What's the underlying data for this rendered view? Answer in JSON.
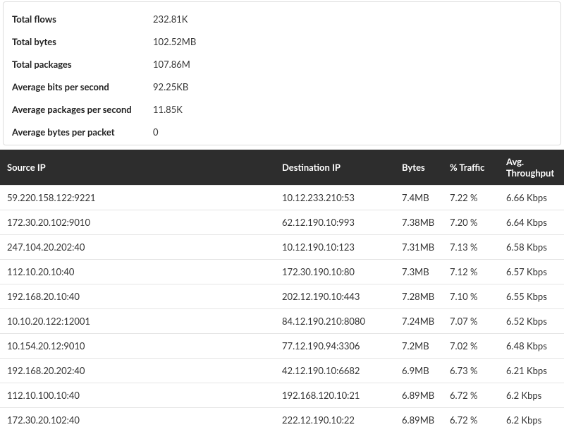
{
  "summary": {
    "rows": [
      {
        "label": "Total flows",
        "value": "232.81K"
      },
      {
        "label": "Total bytes",
        "value": "102.52MB"
      },
      {
        "label": "Total packages",
        "value": "107.86M"
      },
      {
        "label": "Average bits per second",
        "value": "92.25KB"
      },
      {
        "label": "Average packages per second",
        "value": "11.85K"
      },
      {
        "label": "Average bytes per packet",
        "value": "0"
      }
    ]
  },
  "table": {
    "headers": {
      "source": "Source IP",
      "dest": "Destination IP",
      "bytes": "Bytes",
      "pct": "% Traffic",
      "thr": "Avg. Throughput"
    },
    "rows": [
      {
        "source": "59.220.158.122:9221",
        "dest": "10.12.233.210:53",
        "bytes": "7.4MB",
        "pct": "7.22 %",
        "thr": "6.66 Kbps"
      },
      {
        "source": "172.30.20.102:9010",
        "dest": "62.12.190.10:993",
        "bytes": "7.38MB",
        "pct": "7.20 %",
        "thr": "6.64 Kbps"
      },
      {
        "source": "247.104.20.202:40",
        "dest": "10.12.190.10:123",
        "bytes": "7.31MB",
        "pct": "7.13 %",
        "thr": "6.58 Kbps"
      },
      {
        "source": "112.10.20.10:40",
        "dest": "172.30.190.10:80",
        "bytes": "7.3MB",
        "pct": "7.12 %",
        "thr": "6.57 Kbps"
      },
      {
        "source": "192.168.20.10:40",
        "dest": "202.12.190.10:443",
        "bytes": "7.28MB",
        "pct": "7.10 %",
        "thr": "6.55 Kbps"
      },
      {
        "source": "10.10.20.122:12001",
        "dest": "84.12.190.210:8080",
        "bytes": "7.24MB",
        "pct": "7.07 %",
        "thr": "6.52 Kbps"
      },
      {
        "source": "10.154.20.12:9010",
        "dest": "77.12.190.94:3306",
        "bytes": "7.2MB",
        "pct": "7.02 %",
        "thr": "6.48 Kbps"
      },
      {
        "source": "192.168.20.202:40",
        "dest": "42.12.190.10:6682",
        "bytes": "6.9MB",
        "pct": "6.73 %",
        "thr": "6.21 Kbps"
      },
      {
        "source": "112.10.100.10:40",
        "dest": "192.168.120.10:21",
        "bytes": "6.89MB",
        "pct": "6.72 %",
        "thr": "6.2 Kbps"
      },
      {
        "source": "172.30.20.102:40",
        "dest": "222.12.190.10:22",
        "bytes": "6.89MB",
        "pct": "6.72 %",
        "thr": "6.2 Kbps"
      }
    ]
  }
}
